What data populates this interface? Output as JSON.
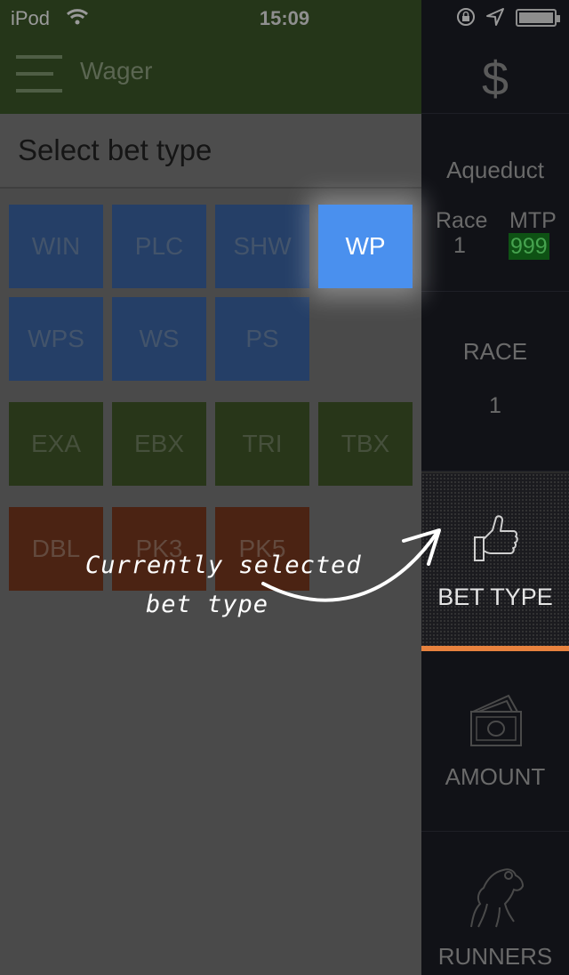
{
  "status_bar": {
    "carrier": "iPod",
    "time": "15:09"
  },
  "app_bar": {
    "title": "Wager"
  },
  "section": {
    "title": "Select bet type"
  },
  "bet_types": {
    "group1": [
      "WIN",
      "PLC",
      "SHW",
      "WP",
      "WPS",
      "WS",
      "PS"
    ],
    "group2": [
      "EXA",
      "EBX",
      "TRI",
      "TBX"
    ],
    "group3": [
      "DBL",
      "PK3",
      "PK5"
    ],
    "selected": "WP"
  },
  "sidebar": {
    "track": "Aqueduct",
    "race_label": "Race",
    "race_number": "1",
    "mtp_label": "MTP",
    "mtp_value": "999",
    "race_section_label": "RACE",
    "race_section_value": "1",
    "bet_type_label": "BET TYPE",
    "amount_label": "AMOUNT",
    "runners_label": "RUNNERS"
  },
  "annotation": {
    "line1": "Currently selected",
    "line2": "bet type"
  },
  "colors": {
    "selected_tile": "#4a90ee",
    "accent_bar": "#e8823e",
    "mtp_badge": "#0e5214"
  }
}
